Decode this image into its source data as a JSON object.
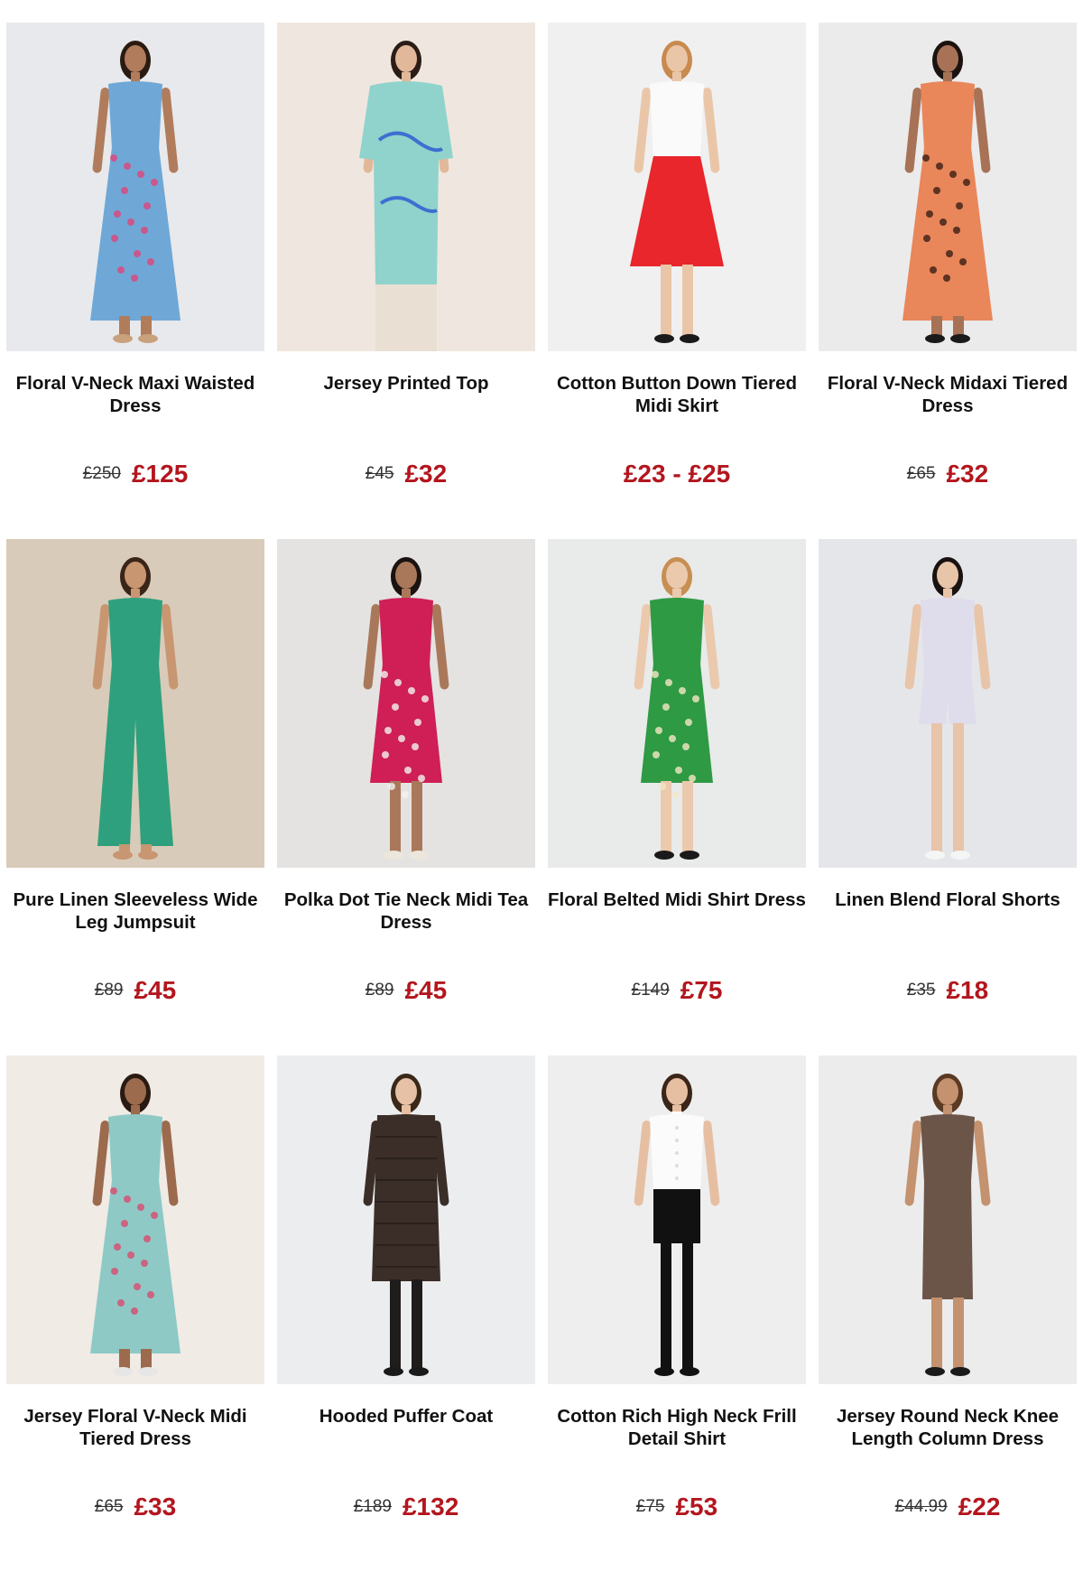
{
  "colors": {
    "sale_price": "#b3161e",
    "was_price": "#333333",
    "title": "#111111"
  },
  "products": [
    {
      "name": "Floral V-Neck Maxi Waisted Dress",
      "was": "£250",
      "now": "£125",
      "image": {
        "bg": "#e8e9ec",
        "skin": "#b07c5c",
        "hair": "#2a1b12",
        "top": "#6fa8d6",
        "bottom": "#6fa8d6",
        "accent": "#e0447a",
        "shoes": "#c9a27d",
        "style": "maxi"
      }
    },
    {
      "name": "Jersey Printed Top",
      "was": "£45",
      "now": "£32",
      "image": {
        "bg": "#efe7df",
        "skin": "#e2b89a",
        "hair": "#2b1d16",
        "top": "#8fd3cc",
        "bottom": "#e9dfd2",
        "accent": "#3d6fd1",
        "shoes": "#e9dfd2",
        "style": "top"
      }
    },
    {
      "name": "Cotton Button Down Tiered Midi Skirt",
      "was": "",
      "now": "£23 - £25",
      "image": {
        "bg": "#f0f0f0",
        "skin": "#eac6a8",
        "hair": "#c98a4e",
        "top": "#fafafa",
        "bottom": "#e8262b",
        "accent": "#1a1a1a",
        "shoes": "#1a1a1a",
        "style": "skirt"
      }
    },
    {
      "name": "Floral V-Neck Midaxi Tiered Dress",
      "was": "£65",
      "now": "£32",
      "image": {
        "bg": "#ebebeb",
        "skin": "#a77256",
        "hair": "#1c1210",
        "top": "#e9865a",
        "bottom": "#e9865a",
        "accent": "#3a1e14",
        "shoes": "#1a1a1a",
        "style": "maxi"
      }
    },
    {
      "name": "Pure Linen Sleeveless Wide Leg Jumpsuit",
      "was": "£89",
      "now": "£45",
      "image": {
        "bg": "#d9cbb9",
        "skin": "#c99672",
        "hair": "#3a2518",
        "top": "#2fa07d",
        "bottom": "#2fa07d",
        "accent": "#8b5a3c",
        "shoes": "#c99672",
        "style": "jumpsuit"
      }
    },
    {
      "name": "Polka Dot Tie Neck Midi Tea Dress",
      "was": "£89",
      "now": "£45",
      "image": {
        "bg": "#e4e3e1",
        "skin": "#a9785a",
        "hair": "#1a1310",
        "top": "#cf1f56",
        "bottom": "#cf1f56",
        "accent": "#f2f2f2",
        "shoes": "#ece6dc",
        "style": "midi"
      }
    },
    {
      "name": "Floral Belted Midi Shirt Dress",
      "was": "£149",
      "now": "£75",
      "image": {
        "bg": "#e9eaea",
        "skin": "#ebc9ad",
        "hair": "#c78f52",
        "top": "#2f9a44",
        "bottom": "#2f9a44",
        "accent": "#f4e7c5",
        "shoes": "#1a1a1a",
        "style": "midi"
      }
    },
    {
      "name": "Linen Blend Floral Shorts",
      "was": "£35",
      "now": "£18",
      "image": {
        "bg": "#e5e6e9",
        "skin": "#e8c4a8",
        "hair": "#1a1210",
        "top": "#dfdcec",
        "bottom": "#dfdcec",
        "accent": "#7d78b2",
        "shoes": "#f5f5f5",
        "style": "shorts"
      }
    },
    {
      "name": "Jersey Floral V-Neck Midi Tiered Dress",
      "was": "£65",
      "now": "£33",
      "image": {
        "bg": "#f0ebe5",
        "skin": "#9c6a4d",
        "hair": "#2a1a12",
        "top": "#8ec9c6",
        "bottom": "#8ec9c6",
        "accent": "#d94b6e",
        "shoes": "#e6e6e6",
        "style": "maxi"
      }
    },
    {
      "name": "Hooded Puffer Coat",
      "was": "£189",
      "now": "£132",
      "image": {
        "bg": "#ecedef",
        "skin": "#e6c1a5",
        "hair": "#3a2818",
        "top": "#3b2e28",
        "bottom": "#1f1c1c",
        "accent": "#2a201c",
        "shoes": "#1a1a1a",
        "style": "coat"
      }
    },
    {
      "name": "Cotton Rich High Neck Frill Detail Shirt",
      "was": "£75",
      "now": "£53",
      "image": {
        "bg": "#eeeeee",
        "skin": "#e6bfa2",
        "hair": "#3b2519",
        "top": "#fbfbfb",
        "bottom": "#111111",
        "accent": "#dddddd",
        "shoes": "#111111",
        "style": "shirt"
      }
    },
    {
      "name": "Jersey Round Neck Knee Length Column Dress",
      "was": "£44.99",
      "now": "£22",
      "image": {
        "bg": "#ececec",
        "skin": "#c4926f",
        "hair": "#5a3a22",
        "top": "#6b5548",
        "bottom": "#6b5548",
        "accent": "#4e3d33",
        "shoes": "#1a1a1a",
        "style": "column"
      }
    }
  ]
}
